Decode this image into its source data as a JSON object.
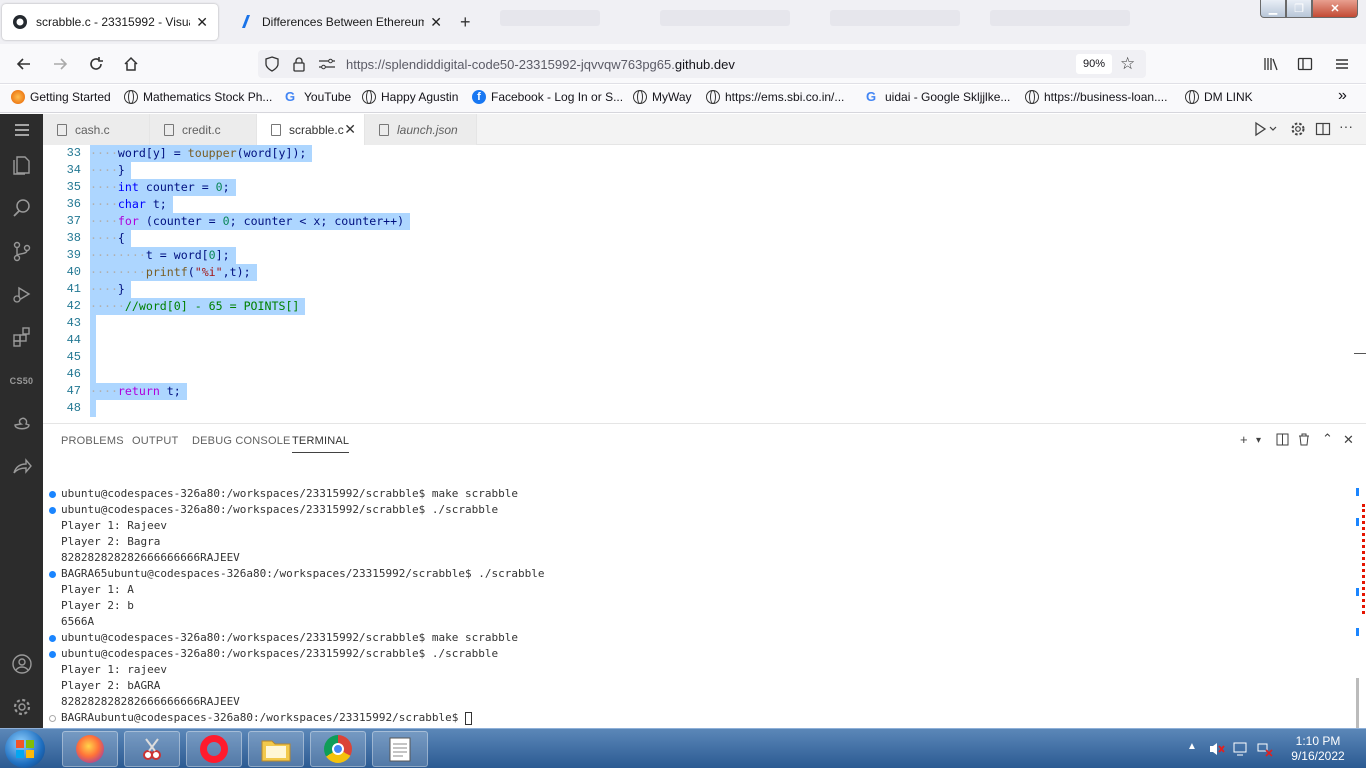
{
  "browser": {
    "tabs": [
      {
        "title": "scrabble.c - 23315992 - Visual St",
        "active": true
      },
      {
        "title": "Differences Between Ethereum",
        "active": false
      }
    ],
    "url_prefix": "https://splendiddigital-code50-23315992-jqvvqw763pg65.",
    "url_domain": "github.dev",
    "zoom": "90%",
    "bookmarks": [
      "Getting Started",
      "Mathematics Stock Ph...",
      "YouTube",
      "Happy Agustin",
      "Facebook - Log In or S...",
      "MyWay",
      "https://ems.sbi.co.in/...",
      "uidai - Google Skljjlke...",
      "https://business-loan....",
      "DM LINK"
    ]
  },
  "vscode": {
    "activity_label": "CS50",
    "editor_tabs": [
      {
        "name": "cash.c",
        "active": false,
        "italic": false
      },
      {
        "name": "credit.c",
        "active": false,
        "italic": false
      },
      {
        "name": "scrabble.c",
        "active": true,
        "italic": false
      },
      {
        "name": "launch.json",
        "active": false,
        "italic": true
      }
    ],
    "line_numbers": [
      "33",
      "34",
      "35",
      "36",
      "37",
      "38",
      "39",
      "40",
      "41",
      "42",
      "43",
      "44",
      "45",
      "46",
      "47",
      "48"
    ],
    "panel_tabs": [
      "PROBLEMS",
      "OUTPUT",
      "DEBUG CONSOLE",
      "TERMINAL"
    ],
    "terminal_lines": [
      {
        "text": "ubuntu@codespaces-326a80:/workspaces/23315992/scrabble$ make scrabble",
        "marker": "blue"
      },
      {
        "text": "ubuntu@codespaces-326a80:/workspaces/23315992/scrabble$ ./scrabble",
        "marker": "blue"
      },
      {
        "text": "Player 1: Rajeev",
        "marker": "none"
      },
      {
        "text": "Player 2: Bagra",
        "marker": "none"
      },
      {
        "text": "828282828282666666666RAJEEV",
        "marker": "none"
      },
      {
        "text": "BAGRA65ubuntu@codespaces-326a80:/workspaces/23315992/scrabble$ ./scrabble",
        "marker": "blue"
      },
      {
        "text": "Player 1: A",
        "marker": "none"
      },
      {
        "text": "Player 2: b",
        "marker": "none"
      },
      {
        "text": "6566A",
        "marker": "none"
      },
      {
        "text": "ubuntu@codespaces-326a80:/workspaces/23315992/scrabble$ make scrabble",
        "marker": "blue"
      },
      {
        "text": "ubuntu@codespaces-326a80:/workspaces/23315992/scrabble$ ./scrabble",
        "marker": "blue"
      },
      {
        "text": "Player 1: rajeev",
        "marker": "none"
      },
      {
        "text": "Player 2: bAGRA",
        "marker": "none"
      },
      {
        "text": "828282828282666666666RAJEEV",
        "marker": "none"
      },
      {
        "text": "BAGRAubuntu@codespaces-326a80:/workspaces/23315992/scrabble$ ",
        "marker": "hollow"
      }
    ]
  },
  "taskbar": {
    "time": "1:10 PM",
    "date": "9/16/2022"
  },
  "colors": {
    "activity_bar": "#2c2c2c",
    "selection": "#add6ff",
    "terminal_marker": "#1a85ff"
  }
}
